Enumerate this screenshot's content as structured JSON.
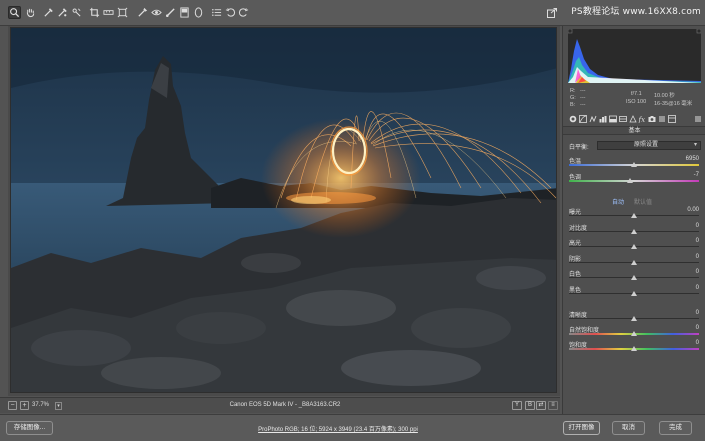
{
  "watermark": "PS教程论坛 www.16XX8.com",
  "toolbar": {
    "tools": [
      "zoom-tool",
      "hand-tool",
      "white-balance-tool",
      "color-sampler-tool",
      "targeted-adjustment-tool",
      "crop-tool",
      "straighten-tool",
      "transform-tool",
      "spot-removal-tool",
      "red-eye-tool",
      "adjustment-brush-tool",
      "graduated-filter-tool",
      "radial-filter-tool",
      "preferences-tool",
      "rotate-left-tool",
      "rotate-right-tool"
    ]
  },
  "preview": {
    "zoom_minus": "−",
    "zoom_plus": "+",
    "zoom_level": "37.7%",
    "camera": "Canon EOS 5D Mark IV - _B8A3163.CR2",
    "view_y": "Y",
    "view_b": "B"
  },
  "meta": {
    "r_label": "R:",
    "g_label": "G:",
    "b_label": "B:",
    "r": "---",
    "g": "---",
    "b": "---",
    "aperture": "f/7.1",
    "shutter": "10.00 秒",
    "iso": "ISO 100",
    "lens": "16-35@16 毫米"
  },
  "panel": {
    "section_title": "基本",
    "wb_label": "白平衡:",
    "wb_value": "原照设置",
    "auto": "自动",
    "default": "默认值",
    "sliders_top": [
      {
        "label": "色温",
        "value": "6950",
        "pos": 0.5
      },
      {
        "label": "色调",
        "value": "-7",
        "pos": 0.47
      }
    ],
    "sliders_tone": [
      {
        "label": "曝光",
        "value": "0.00",
        "pos": 0.5
      },
      {
        "label": "对比度",
        "value": "0",
        "pos": 0.5
      },
      {
        "label": "高光",
        "value": "0",
        "pos": 0.5
      },
      {
        "label": "阴影",
        "value": "0",
        "pos": 0.5
      },
      {
        "label": "白色",
        "value": "0",
        "pos": 0.5
      },
      {
        "label": "黑色",
        "value": "0",
        "pos": 0.5
      }
    ],
    "sliders_presence": [
      {
        "label": "清晰度",
        "value": "0",
        "pos": 0.5
      },
      {
        "label": "自然饱和度",
        "value": "0",
        "pos": 0.5
      },
      {
        "label": "饱和度",
        "value": "0",
        "pos": 0.5
      }
    ]
  },
  "bottom": {
    "save": "存储图像...",
    "workflow": "ProPhoto RGB; 16 位; 5924 x 3949 (23.4 百万像素); 300 ppi",
    "open": "打开图像",
    "cancel": "取消",
    "done": "完成"
  }
}
